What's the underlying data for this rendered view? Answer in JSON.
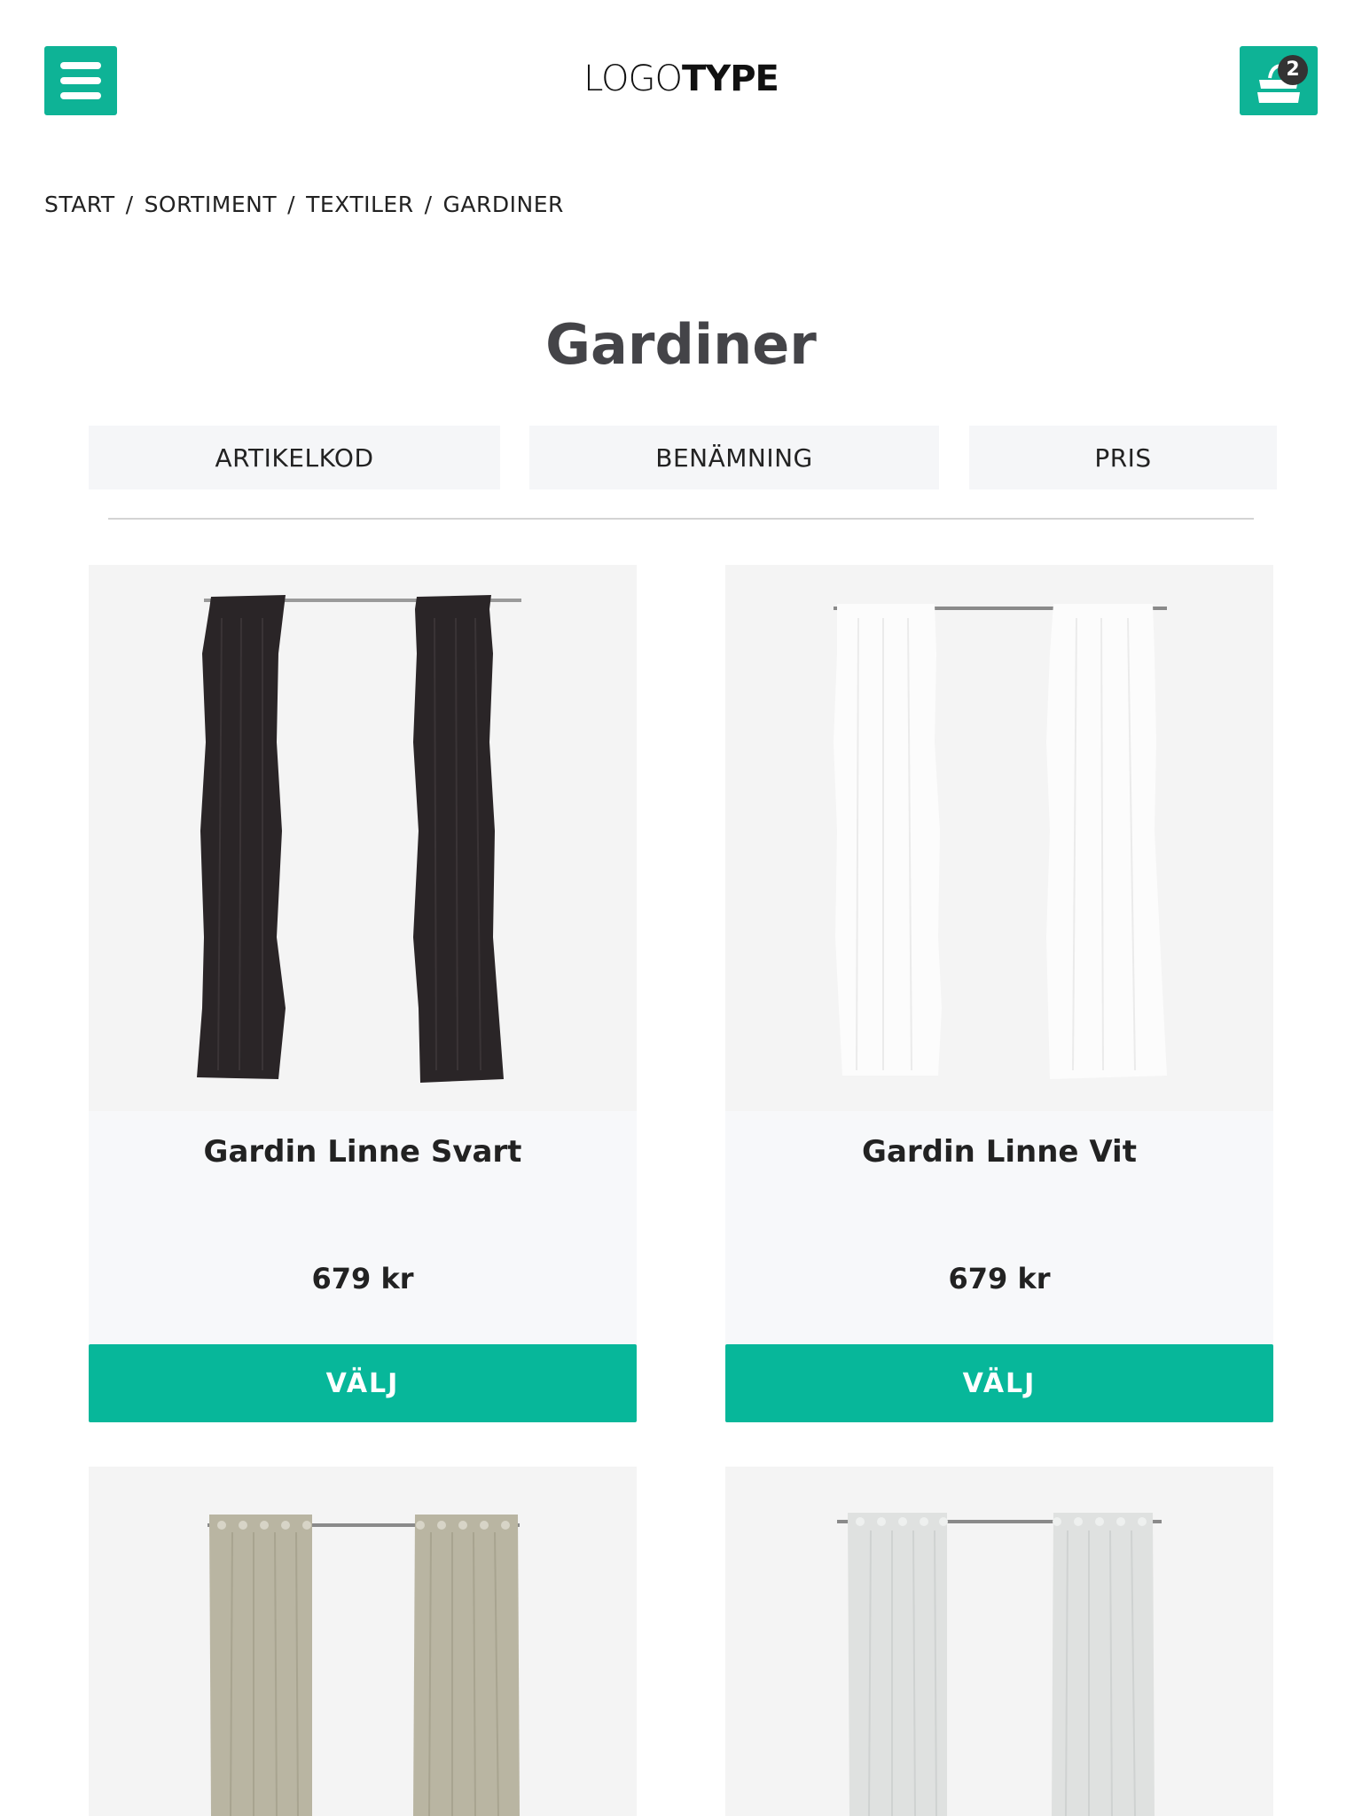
{
  "header": {
    "logo_light": "LOGO",
    "logo_bold": "TYPE",
    "cart_count": "2",
    "accent_color": "#0eb396"
  },
  "breadcrumb": [
    "START",
    "SORTIMENT",
    "TEXTILER",
    "GARDINER"
  ],
  "breadcrumb_separator": "/",
  "page_title": "Gardiner",
  "sort_options": [
    "ARTIKELKOD",
    "BENÄMNING",
    "PRIS"
  ],
  "products": [
    {
      "name": "Gardin Linne Svart",
      "price": "679 kr",
      "button": "VÄLJ",
      "image": "black-linen-curtain"
    },
    {
      "name": "Gardin Linne Vit",
      "price": "679 kr",
      "button": "VÄLJ",
      "image": "white-linen-curtain"
    },
    {
      "image": "beige-eyelet-curtain"
    },
    {
      "image": "light-grey-eyelet-curtain"
    }
  ]
}
